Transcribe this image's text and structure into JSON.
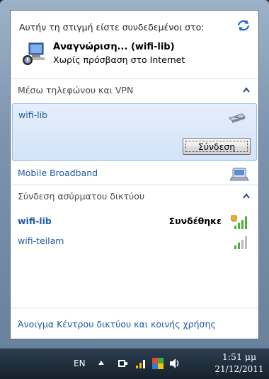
{
  "header": {
    "connected_to": "Αυτήν τη στιγμή είστε συνδεδεμένοι στο:",
    "network_name": "Αναγνώριση... (wifi-lib)",
    "network_status": "Χωρίς πρόσβαση στο Internet"
  },
  "sections": {
    "phone_vpn": "Μέσω τηλεφώνου και VPN",
    "wireless": "Σύνδεση ασύρματου δικτύου"
  },
  "phone_vpn_items": [
    {
      "name": "wifi-lib",
      "button": "Σύνδεση"
    },
    {
      "name": "Mobile Broadband"
    }
  ],
  "wireless_items": [
    {
      "name": "wifi-lib",
      "status": "Συνδέθηκε"
    },
    {
      "name": "wifi-teilam",
      "status": ""
    }
  ],
  "footer": {
    "link": "Άνοιγμα Κέντρου δικτύου και κοινής χρήσης"
  },
  "taskbar": {
    "language": "EN",
    "time": "1:51 μμ",
    "date": "21/12/2011"
  },
  "colors": {
    "link": "#1f5aa8",
    "selection": "#d3e3f9"
  }
}
